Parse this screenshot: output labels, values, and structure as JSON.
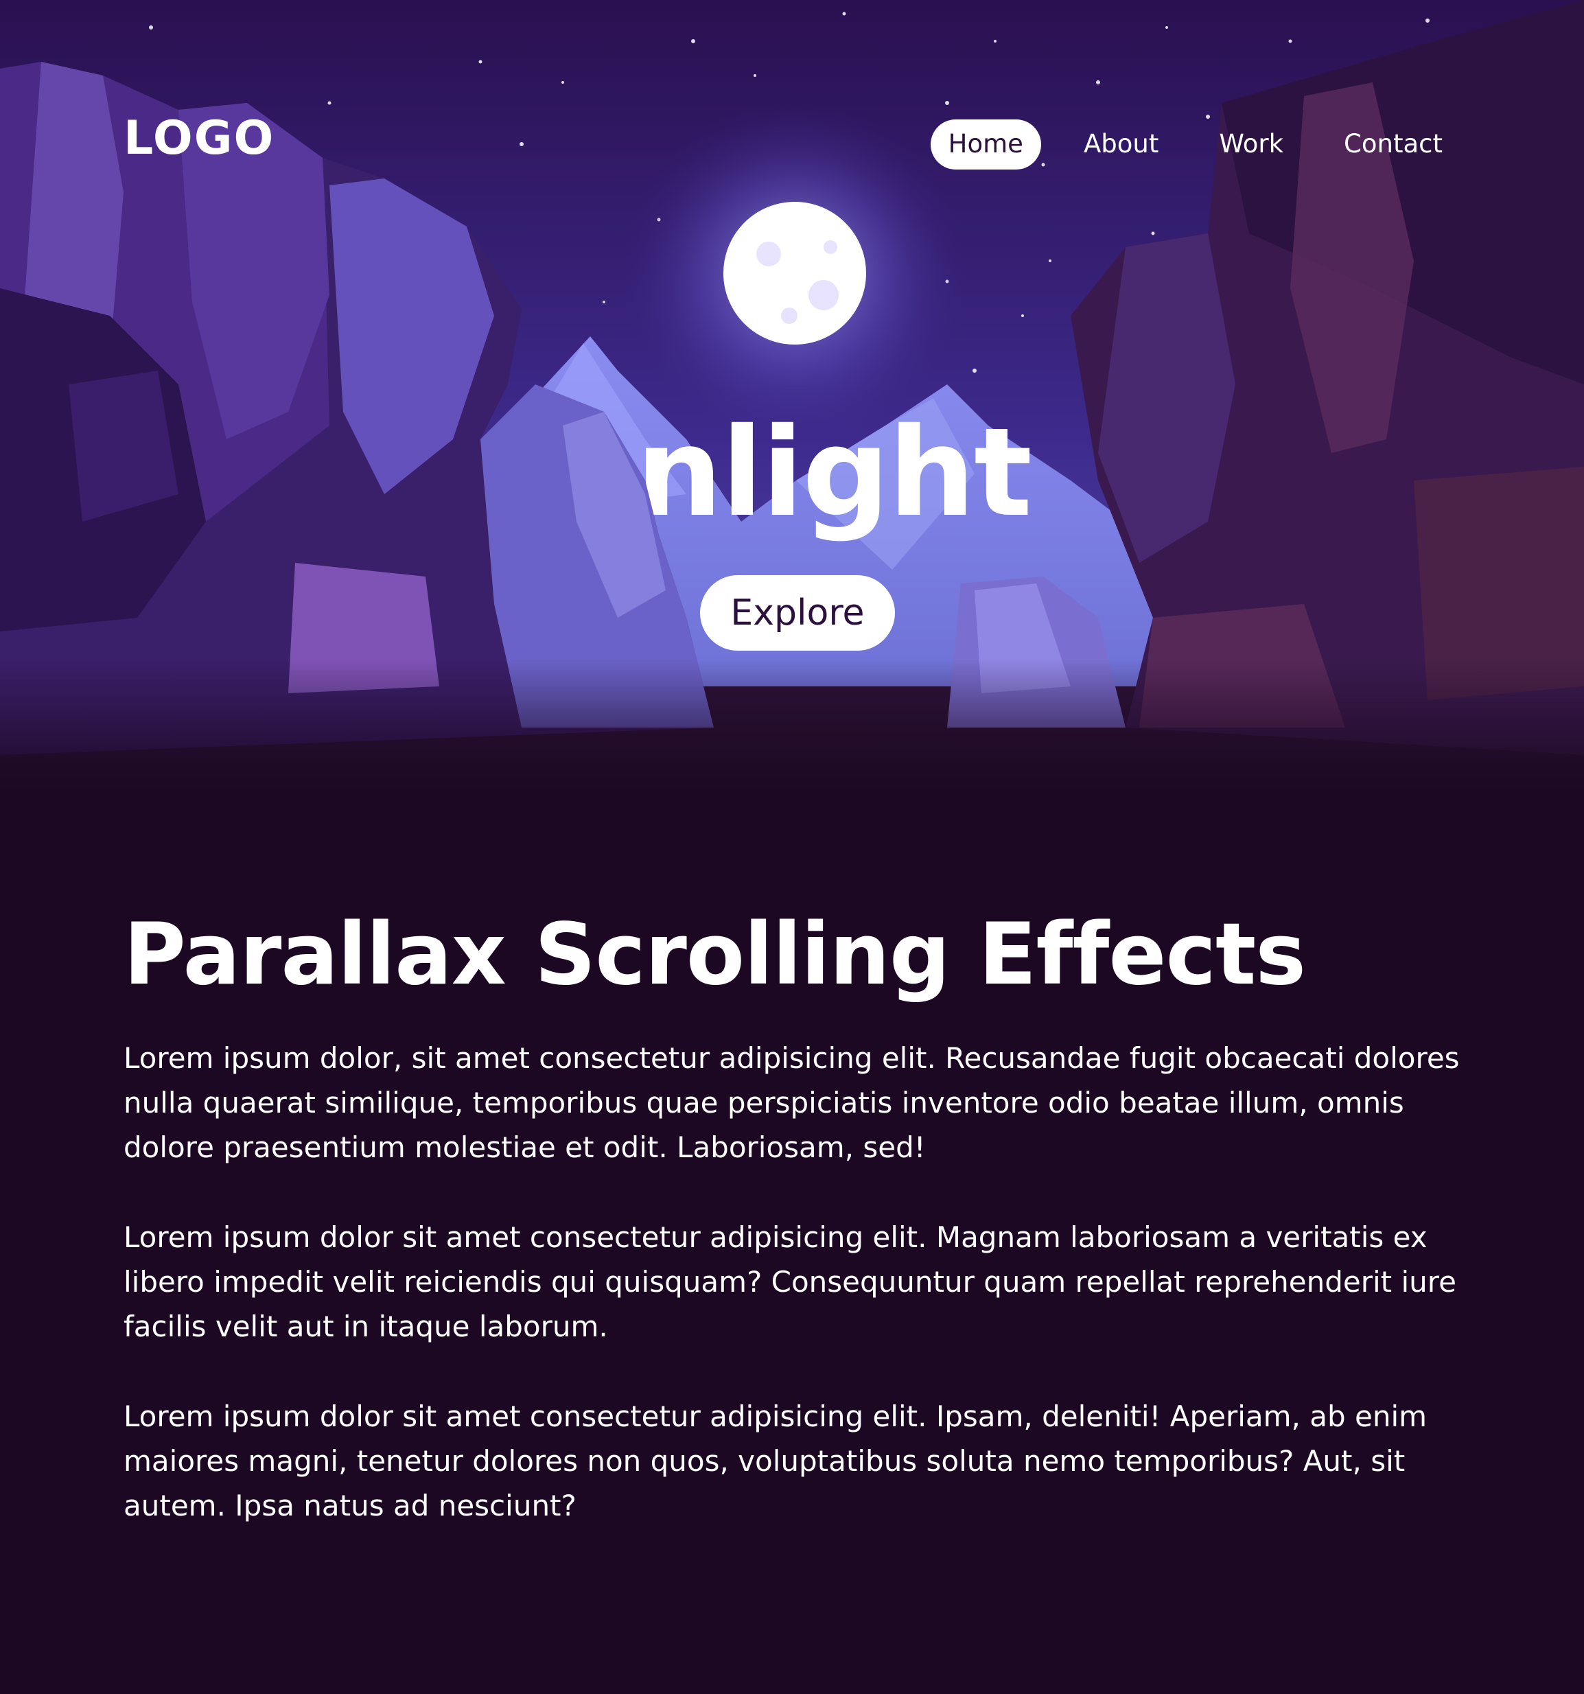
{
  "header": {
    "logo": "LOGO",
    "nav": [
      {
        "label": "Home",
        "active": true
      },
      {
        "label": "About",
        "active": false
      },
      {
        "label": "Work",
        "active": false
      },
      {
        "label": "Contact",
        "active": false
      }
    ]
  },
  "hero": {
    "title": "Moonlight",
    "visible_title": "onlight",
    "button_label": "Explore"
  },
  "main": {
    "heading": "Parallax Scrolling Effects",
    "paragraphs": [
      "Lorem ipsum dolor, sit amet consectetur adipisicing elit. Recusandae fugit obcaecati dolores nulla quaerat similique, temporibus quae perspiciatis inventore odio beatae illum, omnis dolore praesentium molestiae et odit. Laboriosam, sed!",
      "Lorem ipsum dolor sit amet consectetur adipisicing elit. Magnam laboriosam a veritatis ex libero impedit velit reiciendis qui quisquam? Consequuntur quam repellat reprehenderit iure facilis velit aut in itaque laborum.",
      "Lorem ipsum dolor sit amet consectetur adipisicing elit. Ipsam, deleniti! Aperiam, ab enim maiores magni, tenetur dolores non quos, voluptatibus soluta nemo temporibus? Aut, sit autem. Ipsa natus ad nesciunt?"
    ]
  },
  "colors": {
    "background": "#1c0822",
    "sky_top": "#2a1050",
    "sky_bottom": "#4a3ca0",
    "moon": "#ffffff",
    "accent_text": "#2b0f3d"
  },
  "icons": [
    "moon-icon"
  ]
}
